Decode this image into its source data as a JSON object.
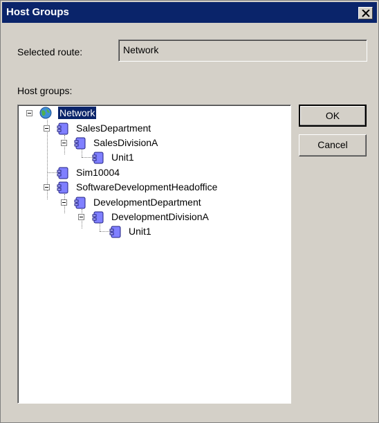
{
  "window": {
    "title": "Host Groups"
  },
  "route": {
    "label": "Selected route:",
    "value": "Network"
  },
  "tree": {
    "label": "Host groups:",
    "nodes": {
      "network": "Network",
      "sales_department": "SalesDepartment",
      "sales_division_a": "SalesDivisionA",
      "sales_unit1": "Unit1",
      "sim10004": "Sim10004",
      "software_dev_headoffice": "SoftwareDevelopmentHeadoffice",
      "development_department": "DevelopmentDepartment",
      "development_division_a": "DevelopmentDivisionA",
      "dev_unit1": "Unit1"
    }
  },
  "buttons": {
    "ok": "OK",
    "cancel": "Cancel"
  },
  "colors": {
    "titlebar": "#0a246a",
    "dialog_bg": "#d4d0c8",
    "selection": "#0a246a"
  },
  "icons": {
    "root": "globe-icon",
    "group": "server-group-icon"
  }
}
